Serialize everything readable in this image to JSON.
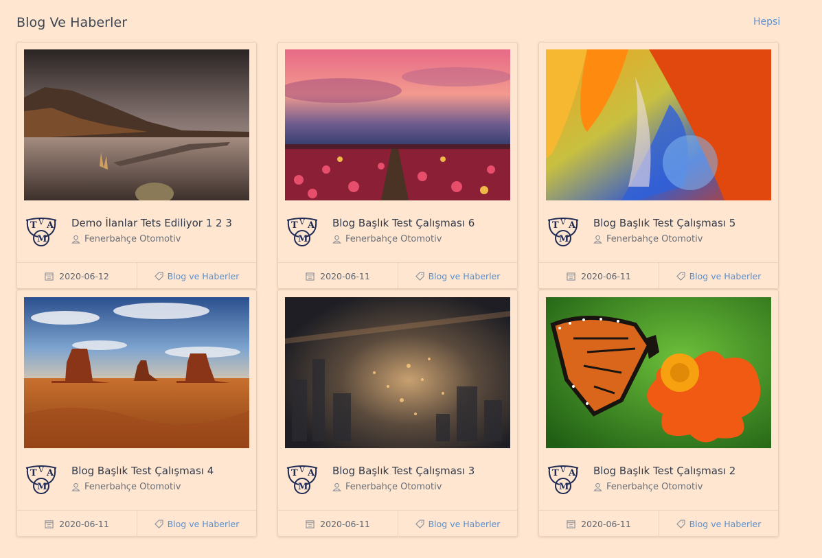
{
  "section": {
    "title": "Blog Ve Haberler",
    "see_all": "Hepsi"
  },
  "logo": {
    "letter_left": "T",
    "letter_middle": "V",
    "letter_right": "A",
    "letter_bottom": "M"
  },
  "cards": [
    {
      "title": "Demo İlanlar Tets Ediliyor 1 2 3",
      "author": "Fenerbahçe Otomotiv",
      "date": "2020-06-12",
      "category": "Blog ve Haberler",
      "image": "lake-landscape"
    },
    {
      "title": "Blog Başlık Test Çalışması 6",
      "author": "Fenerbahçe Otomotiv",
      "date": "2020-06-11",
      "category": "Blog ve Haberler",
      "image": "tulip-field-sunset"
    },
    {
      "title": "Blog Başlık Test Çalışması 5",
      "author": "Fenerbahçe Otomotiv",
      "date": "2020-06-11",
      "category": "Blog ve Haberler",
      "image": "abstract-petals"
    },
    {
      "title": "Blog Başlık Test Çalışması 4",
      "author": "Fenerbahçe Otomotiv",
      "date": "2020-06-11",
      "category": "Blog ve Haberler",
      "image": "desert-monument-valley"
    },
    {
      "title": "Blog Başlık Test Çalışması 3",
      "author": "Fenerbahçe Otomotiv",
      "date": "2020-06-11",
      "category": "Blog ve Haberler",
      "image": "city-aerial-night"
    },
    {
      "title": "Blog Başlık Test Çalışması 2",
      "author": "Fenerbahçe Otomotiv",
      "date": "2020-06-11",
      "category": "Blog ve Haberler",
      "image": "butterfly-flower"
    }
  ],
  "colors": {
    "background": "#fee6d0",
    "link": "#5b8fcf",
    "logo": "#1f2a55"
  }
}
